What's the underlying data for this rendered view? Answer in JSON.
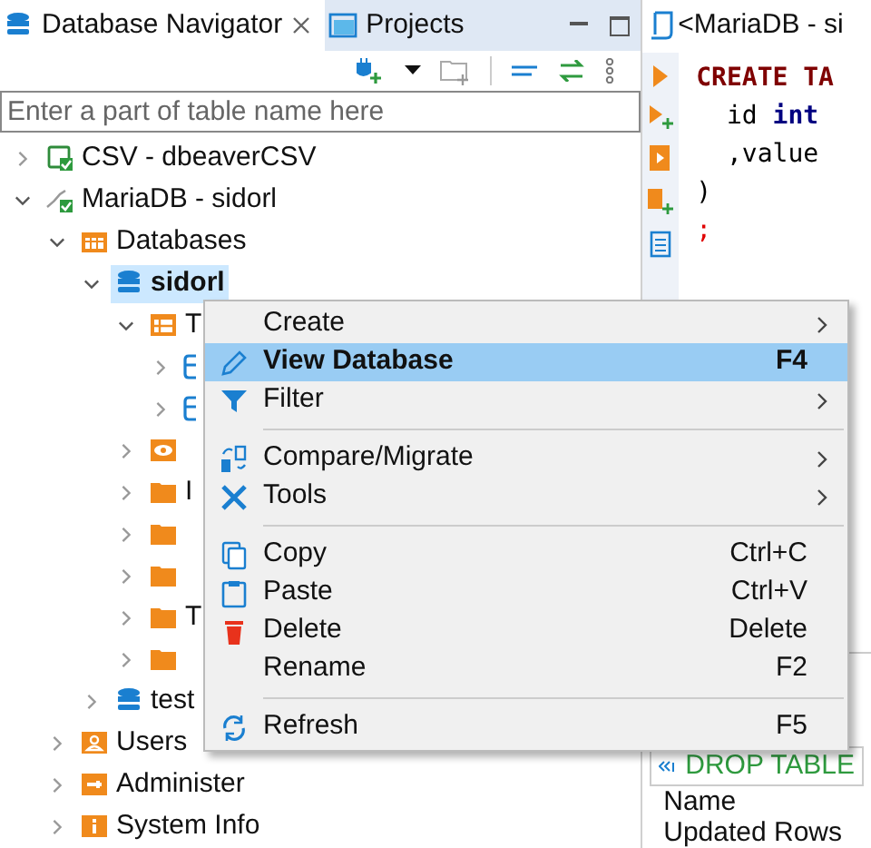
{
  "navigator": {
    "tabs": [
      {
        "label": "Database Navigator",
        "selected": true,
        "closable": true
      },
      {
        "label": "Projects",
        "selected": false,
        "closable": false
      }
    ],
    "filter": {
      "placeholder": "Enter a part of table name here"
    },
    "tree": [
      {
        "label": "CSV - dbeaverCSV",
        "kind": "csv",
        "expanded": false,
        "selected": false
      },
      {
        "label": "MariaDB - sidorl",
        "kind": "connection",
        "expanded": true,
        "selected": false,
        "children": [
          {
            "label": "Databases",
            "kind": "databases",
            "expanded": true,
            "selected": false,
            "children": [
              {
                "label": "sidorl",
                "kind": "database",
                "expanded": true,
                "selected": true,
                "children": [
                  {
                    "label": "T",
                    "kind": "tables",
                    "expanded": true,
                    "selected": false,
                    "children": [
                      {
                        "kind": "table",
                        "expanded": false,
                        "selected": false
                      },
                      {
                        "kind": "table",
                        "expanded": false,
                        "selected": false
                      }
                    ]
                  },
                  {
                    "kind": "view",
                    "expanded": false,
                    "selected": false
                  },
                  {
                    "label": "I",
                    "kind": "folder",
                    "expanded": false,
                    "selected": false
                  },
                  {
                    "kind": "folder",
                    "expanded": false,
                    "selected": false
                  },
                  {
                    "kind": "folder",
                    "expanded": false,
                    "selected": false
                  },
                  {
                    "label": "T",
                    "kind": "folder",
                    "expanded": false,
                    "selected": false
                  },
                  {
                    "kind": "folder",
                    "expanded": false,
                    "selected": false
                  }
                ]
              },
              {
                "label": "test",
                "kind": "database",
                "expanded": false,
                "selected": false
              }
            ]
          },
          {
            "label": "Users",
            "kind": "users",
            "expanded": false,
            "selected": false
          },
          {
            "label": "Administer",
            "kind": "admin",
            "expanded": false,
            "selected": false
          },
          {
            "label": "System Info",
            "kind": "info",
            "expanded": false,
            "selected": false
          }
        ]
      }
    ]
  },
  "editor": {
    "tab": "<MariaDB - si",
    "code": [
      [
        {
          "text": "CREATE TA",
          "kind": "keyword"
        }
      ],
      [
        {
          "text": "  id ",
          "kind": "plain"
        },
        {
          "text": "int",
          "kind": "type"
        }
      ],
      [
        {
          "text": "  ,value",
          "kind": "plain"
        }
      ],
      [
        {
          "text": ")",
          "kind": "plain"
        }
      ],
      [
        {
          "text": ";",
          "kind": "punct"
        }
      ]
    ],
    "results": {
      "query": "DROP TABLE",
      "rows": [
        "Name",
        "Updated Rows"
      ]
    }
  },
  "context_menu": [
    {
      "kind": "item",
      "label": "Create",
      "submenu": true,
      "selected": false
    },
    {
      "kind": "item",
      "label": "View Database",
      "shortcut": "F4",
      "submenu": false,
      "selected": true
    },
    {
      "kind": "item",
      "label": "Filter",
      "submenu": true,
      "selected": false
    },
    {
      "kind": "separator"
    },
    {
      "kind": "item",
      "label": "Compare/Migrate",
      "submenu": true,
      "selected": false
    },
    {
      "kind": "item",
      "label": "Tools",
      "submenu": true,
      "selected": false
    },
    {
      "kind": "separator"
    },
    {
      "kind": "item",
      "label": "Copy",
      "shortcut": "Ctrl+C",
      "submenu": false,
      "selected": false
    },
    {
      "kind": "item",
      "label": "Paste",
      "shortcut": "Ctrl+V",
      "submenu": false,
      "selected": false
    },
    {
      "kind": "item",
      "label": "Delete",
      "shortcut": "Delete",
      "submenu": false,
      "selected": false
    },
    {
      "kind": "item",
      "label": "Rename",
      "shortcut": "F2",
      "submenu": false,
      "selected": false
    },
    {
      "kind": "separator"
    },
    {
      "kind": "item",
      "label": "Refresh",
      "shortcut": "F5",
      "submenu": false,
      "selected": false
    }
  ]
}
